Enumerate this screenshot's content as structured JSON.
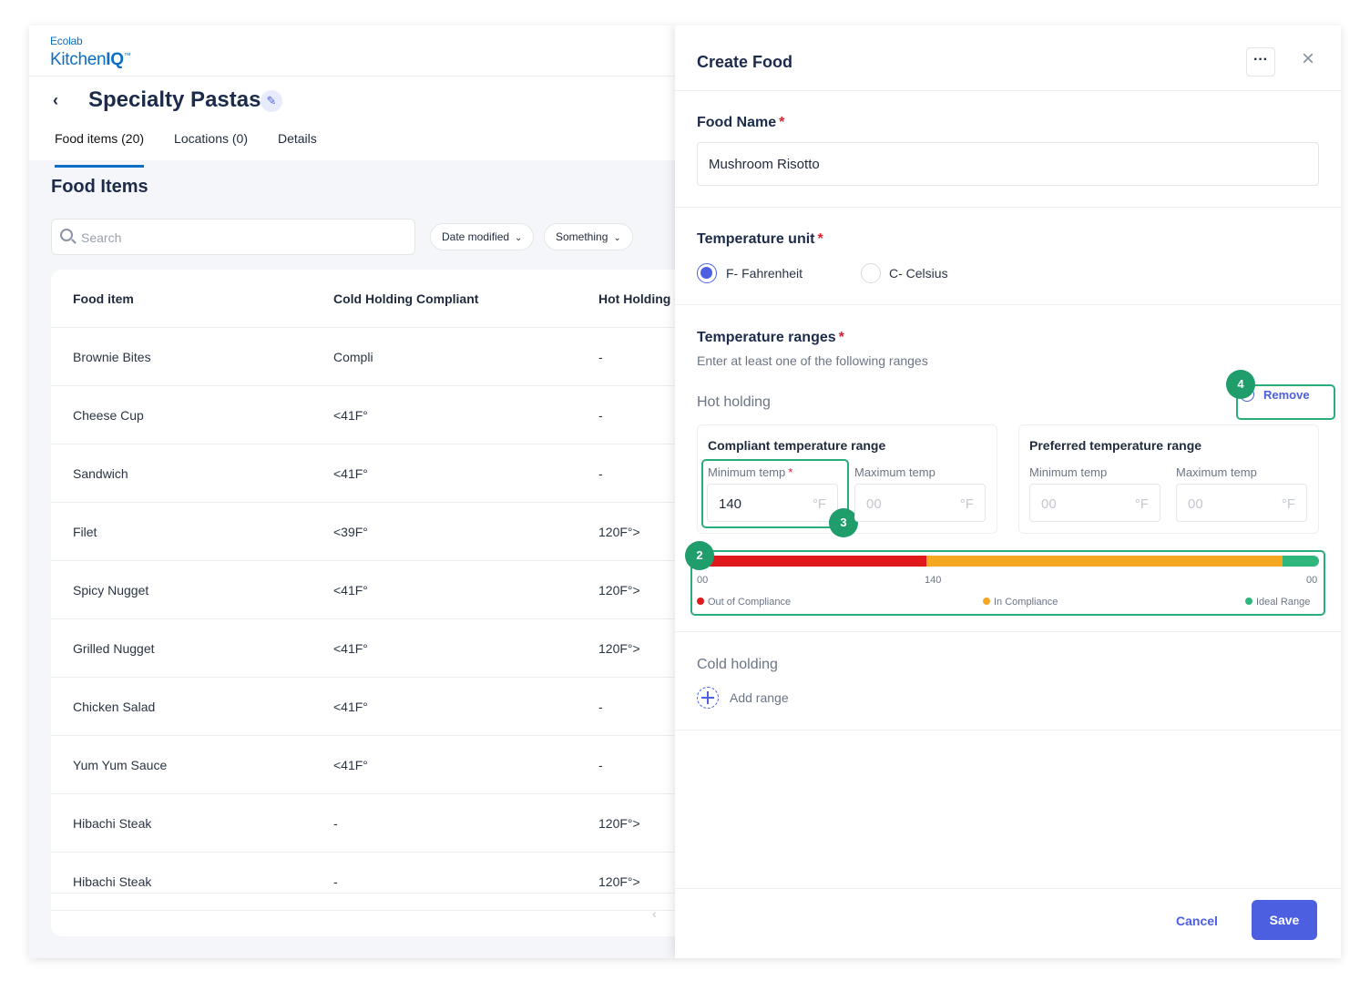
{
  "logo": {
    "brand": "Ecolab",
    "product_prefix": "Kitchen",
    "product_suffix": "IQ"
  },
  "page": {
    "title": "Specialty Pastas"
  },
  "tabs": [
    {
      "label": "Food items (20)"
    },
    {
      "label": "Locations (0)"
    },
    {
      "label": "Details"
    }
  ],
  "section_title": "Food Items",
  "search": {
    "placeholder": "Search"
  },
  "filters": [
    {
      "label": "Date modified"
    },
    {
      "label": "Something"
    }
  ],
  "table": {
    "headers": [
      "Food item",
      "Cold Holding Compliant",
      "Hot Holding C"
    ],
    "rows": [
      [
        "Brownie Bites",
        "Compli",
        "-"
      ],
      [
        "Cheese Cup",
        "<41F°",
        "-"
      ],
      [
        "Sandwich",
        "<41F°",
        "-"
      ],
      [
        "Filet",
        "<39F°",
        "120F°>"
      ],
      [
        "Spicy Nugget",
        "<41F°",
        "120F°>"
      ],
      [
        "Grilled Nugget",
        "<41F°",
        "120F°>"
      ],
      [
        "Chicken Salad",
        "<41F°",
        "-"
      ],
      [
        "Yum Yum Sauce",
        "<41F°",
        "-"
      ],
      [
        "Hibachi Steak",
        "-",
        "120F°>"
      ],
      [
        "Hibachi Steak",
        "-",
        "120F°>"
      ]
    ]
  },
  "drawer": {
    "title": "Create Food",
    "food_name": {
      "label": "Food Name",
      "value": "Mushroom Risotto"
    },
    "temperature_unit": {
      "label": "Temperature unit",
      "options": [
        {
          "label": "F- Fahrenheit",
          "selected": true
        },
        {
          "label": "C- Celsius",
          "selected": false
        }
      ]
    },
    "temperature_ranges": {
      "label": "Temperature ranges",
      "hint": "Enter at least one of the following ranges",
      "hot_holding": {
        "label": "Hot holding",
        "remove_label": "Remove",
        "compliant": {
          "title": "Compliant temperature range",
          "min_label": "Minimum temp",
          "min_value": "140",
          "max_label": "Maximum temp",
          "max_placeholder": "00",
          "unit": "°F"
        },
        "preferred": {
          "title": "Preferred temperature range",
          "min_label": "Minimum temp",
          "min_placeholder": "00",
          "max_label": "Maximum temp",
          "max_placeholder": "00",
          "unit": "°F"
        },
        "bar": {
          "segments": [
            {
              "name": "Out of Compliance",
              "color": "#e0191f",
              "fraction": 0.36
            },
            {
              "name": "In Compliance",
              "color": "#f5a623",
              "fraction": 0.58
            },
            {
              "name": "Ideal Range",
              "color": "#2fb67c",
              "fraction": 0.06
            }
          ],
          "ticks": [
            "00",
            "140",
            "00"
          ],
          "legend": [
            "Out of Compliance",
            "In Compliance",
            "Ideal Range"
          ]
        }
      },
      "cold_holding": {
        "label": "Cold holding",
        "add_label": "Add range"
      }
    },
    "annotations": [
      "2",
      "3",
      "4"
    ],
    "footer": {
      "cancel": "Cancel",
      "save": "Save"
    }
  }
}
